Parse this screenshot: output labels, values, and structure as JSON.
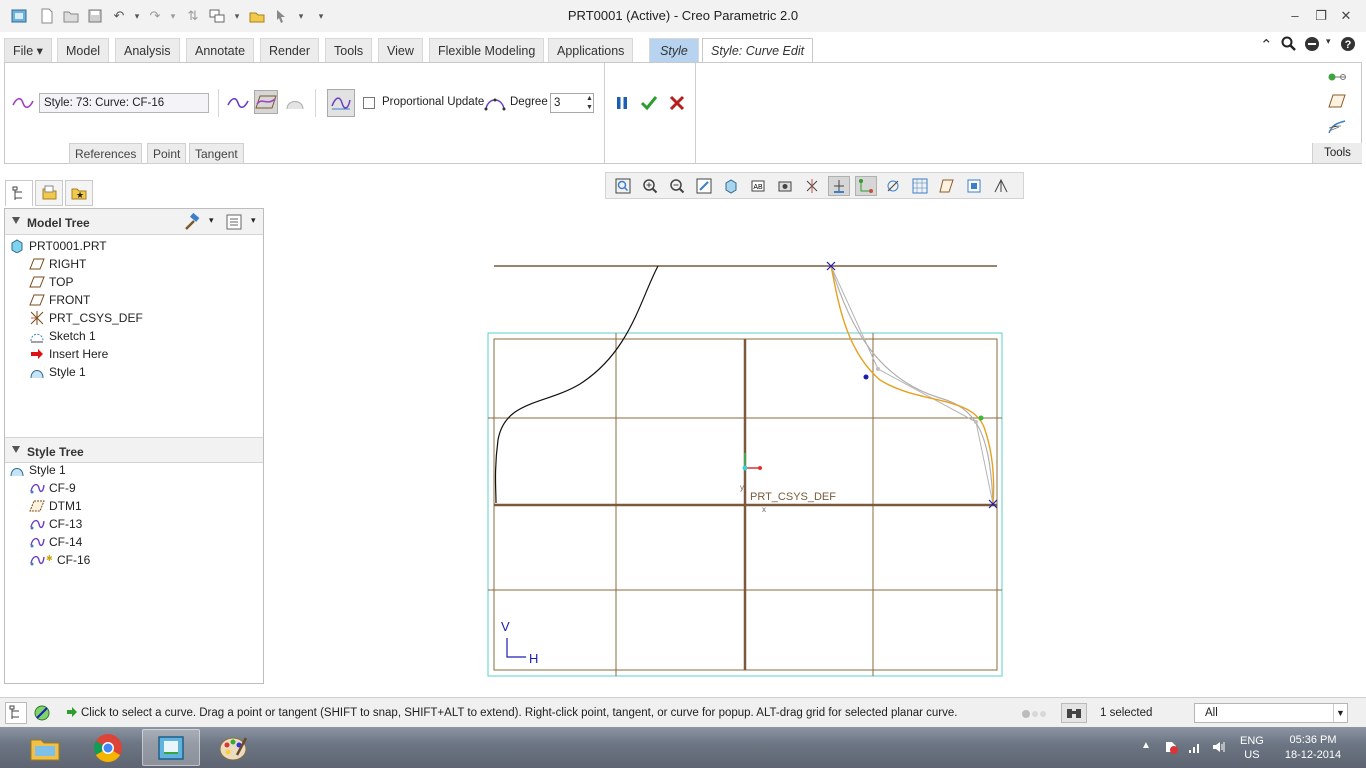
{
  "window": {
    "title": "PRT0001 (Active) - Creo Parametric 2.0",
    "colors": {
      "accent": "#b7d3ef",
      "grid": "#8b6a3e",
      "frame": "#5fcfcf",
      "selected_curve": "#e8a020"
    }
  },
  "ribbon_tabs": [
    {
      "label": "File ▾"
    },
    {
      "label": "Model"
    },
    {
      "label": "Analysis"
    },
    {
      "label": "Annotate"
    },
    {
      "label": "Render"
    },
    {
      "label": "Tools"
    },
    {
      "label": "View"
    },
    {
      "label": "Flexible Modeling"
    },
    {
      "label": "Applications"
    },
    {
      "label": "Style"
    },
    {
      "label": "Style: Curve Edit"
    }
  ],
  "curve_edit": {
    "curve_field": "Style: 73: Curve:   CF-16",
    "proportional_update_label": "Proportional Update",
    "degree_label": "Degree",
    "degree_value": "3",
    "sub_tabs": [
      "References",
      "Point",
      "Tangent"
    ],
    "tools_label": "Tools"
  },
  "model_tree": {
    "title": "Model Tree",
    "root": "PRT0001.PRT",
    "items": [
      {
        "label": "RIGHT",
        "icon": "datum-plane-icon"
      },
      {
        "label": "TOP",
        "icon": "datum-plane-icon"
      },
      {
        "label": "FRONT",
        "icon": "datum-plane-icon"
      },
      {
        "label": "PRT_CSYS_DEF",
        "icon": "csys-icon"
      },
      {
        "label": "Sketch 1",
        "icon": "sketch-icon"
      },
      {
        "label": "Insert Here",
        "icon": "insert-arrow-icon"
      },
      {
        "label": "Style 1",
        "icon": "style-feature-icon"
      }
    ]
  },
  "style_tree": {
    "title": "Style Tree",
    "root": "Style 1",
    "items": [
      {
        "label": "CF-9"
      },
      {
        "label": "DTM1"
      },
      {
        "label": "CF-13"
      },
      {
        "label": "CF-14"
      },
      {
        "label": "CF-16"
      }
    ]
  },
  "canvas": {
    "csys_label": "PRT_CSYS_DEF",
    "axis_v": "V",
    "axis_h": "H"
  },
  "status": {
    "message": "Click to select a curve.  Drag a point or tangent (SHIFT to snap, SHIFT+ALT to extend). Right-click point, tangent, or curve for popup. ALT-drag grid for selected planar curve.",
    "selection_count": "1 selected",
    "filter_value": "All"
  },
  "taskbar": {
    "lang_top": "ENG",
    "lang_bottom": "US",
    "time": "05:36 PM",
    "date": "18-12-2014"
  }
}
